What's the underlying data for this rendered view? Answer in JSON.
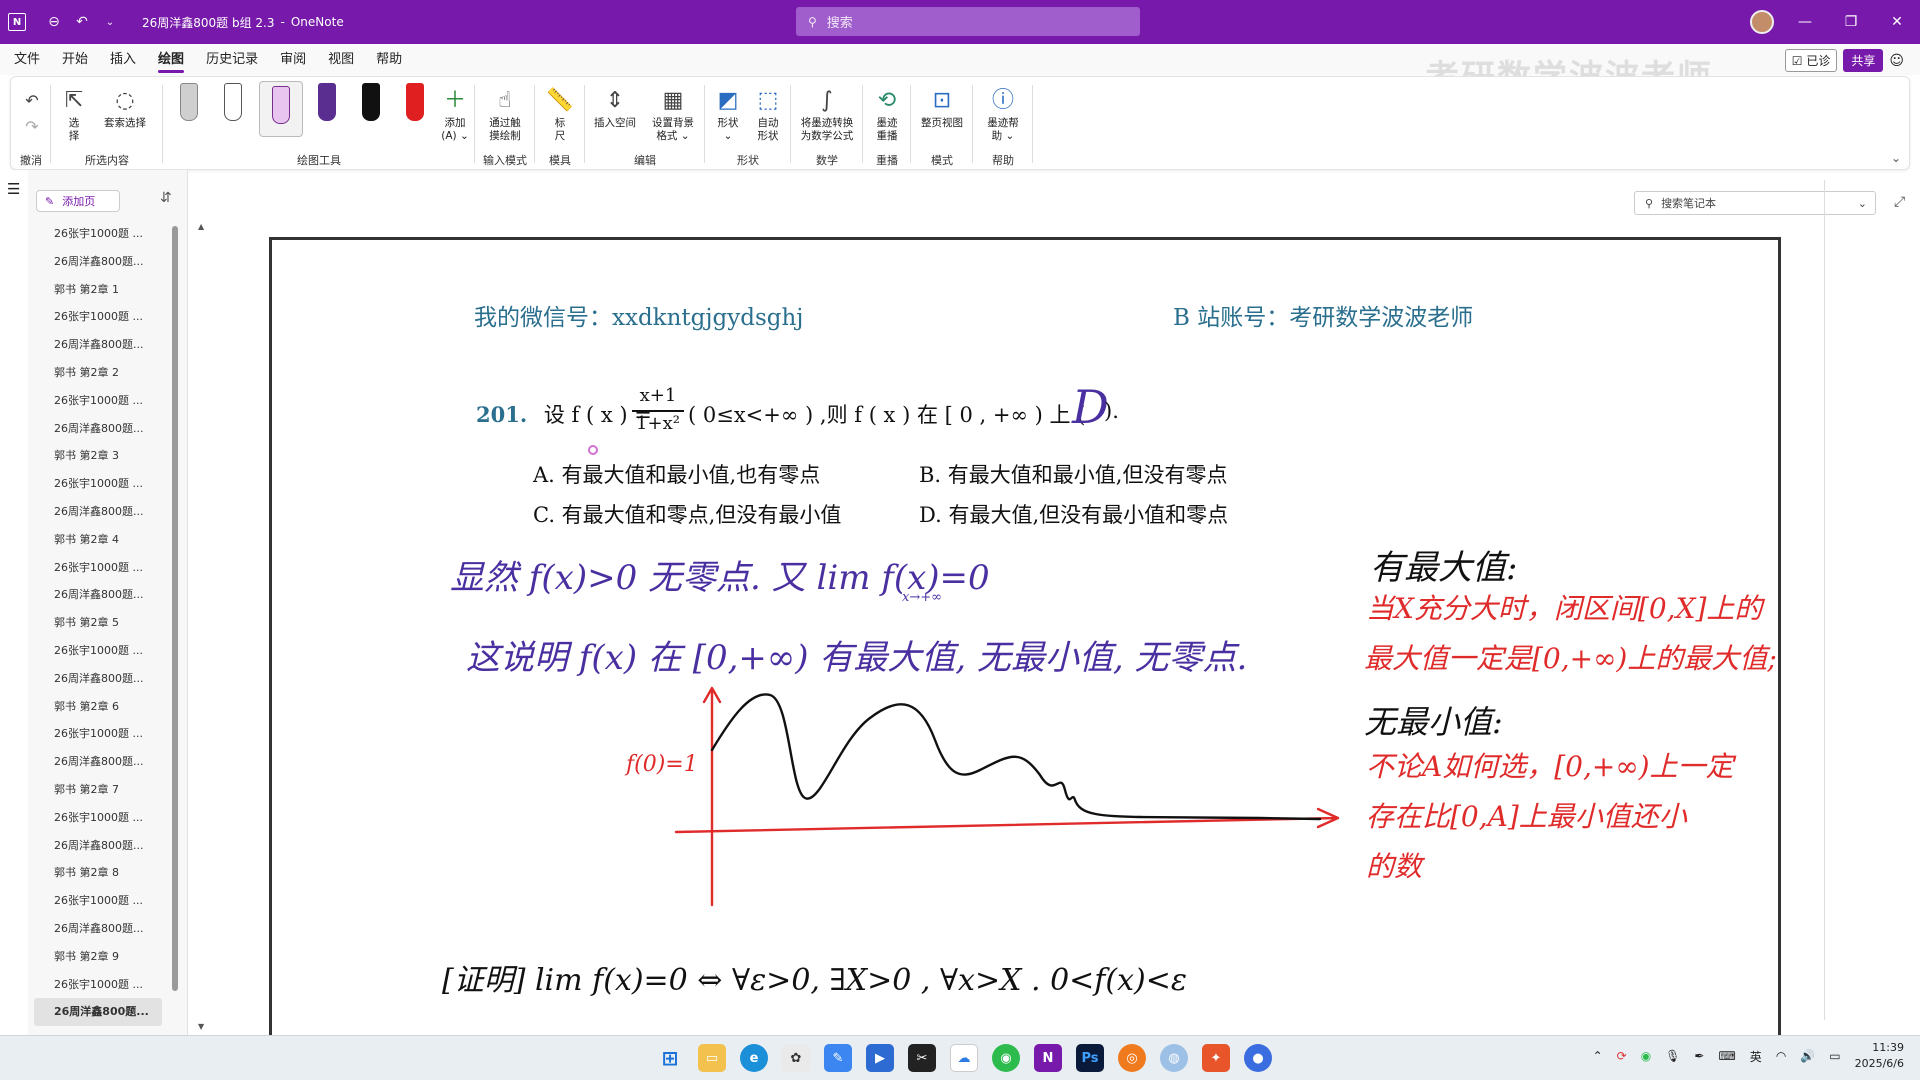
{
  "titlebar": {
    "doc_title": "26周洋鑫800题 b组 2.3",
    "app_name": "OneNote",
    "search_placeholder": "搜索",
    "app_icon": "N"
  },
  "menu": [
    "文件",
    "开始",
    "插入",
    "绘图",
    "历史记录",
    "审阅",
    "视图",
    "帮助"
  ],
  "watermark": "考研数学波波老师",
  "right_tools": {
    "check": "☑ 已诊",
    "share": "共享"
  },
  "ribbon": {
    "undo_label": "撤消",
    "select_buttons": [
      "选\n择",
      "套索选择"
    ],
    "select_group": "所选内容",
    "add_label": "添加\n(A) ⌄",
    "draw_group": "绘图工具",
    "touch_label": "通过触\n摸绘制",
    "input_group": "输入模式",
    "ruler_label": "标\n尺",
    "template_group": "模具",
    "edit_buttons": [
      "插入空间",
      "设置背景\n格式 ⌄"
    ],
    "edit_group": "编辑",
    "shape_buttons": [
      "形状\n⌄",
      "自动\n形状"
    ],
    "shape_group": "形状",
    "math_button": "将墨迹转换\n为数学公式",
    "math_group": "数学",
    "replay_button": "墨迹\n重播",
    "replay_group": "重播",
    "page_view_button": "整页视图",
    "mode_group": "模式",
    "help_button": "墨迹帮\n助 ⌄",
    "help_group": "帮助"
  },
  "pens": [
    "#b7b7b7",
    "#ffffff",
    "#e8c5ef",
    "#5a2d91",
    "#111111",
    "#e02020"
  ],
  "sidebar": {
    "add_page": "添加页",
    "pages": [
      "26张宇1000题 ...",
      "26周洋鑫800题...",
      "郭书 第2章 1",
      "26张宇1000题 ...",
      "26周洋鑫800题...",
      "郭书 第2章 2",
      "26张宇1000题 ...",
      "26周洋鑫800题...",
      "郭书 第2章 3",
      "26张宇1000题 ...",
      "26周洋鑫800题...",
      "郭书 第2章 4",
      "26张宇1000题 ...",
      "26周洋鑫800题...",
      "郭书 第2章 5",
      "26张宇1000题 ...",
      "26周洋鑫800题...",
      "郭书 第2章 6",
      "26张宇1000题 ...",
      "26周洋鑫800题...",
      "郭书 第2章 7",
      "26张宇1000题 ...",
      "26周洋鑫800题...",
      "郭书 第2章 8",
      "26张宇1000题 ...",
      "26周洋鑫800题...",
      "郭书 第2章 9",
      "26张宇1000题 ...",
      "26周洋鑫800题..."
    ],
    "selected_index": 28
  },
  "notebook_search": "搜索笔记本",
  "doc": {
    "wechat": "我的微信号：xxdkntgjgydsghj",
    "bilibili": "B 站账号：考研数学波波老师",
    "q_num": "201.",
    "q_pre": "设 f ( x ) =",
    "frac_num": "x+1",
    "frac_den": "1+x²",
    "q_post": "( 0≤x<+∞ ) ,则 f ( x ) 在 [ 0 , +∞ ) 上 (",
    "q_answer": "D",
    "q_end": ").",
    "opt_a": "A. 有最大值和最小值,也有零点",
    "opt_b": "B. 有最大值和最小值,但没有零点",
    "opt_c": "C. 有最大值和零点,但没有最小值",
    "opt_d": "D. 有最大值,但没有最小值和零点"
  },
  "handwriting": {
    "line1": "显然   f(x)>0   无零点.   又  lim f(x)=0",
    "line1_sub": "x→+∞",
    "line2": "这说明 f(x) 在 [0,+∞) 有最大值, 无最小值, 无零点.",
    "f0_label": "f(0)=1",
    "right_title1": "有最大值:",
    "right_red1": [
      "当X充分大时，闭区间[0,X]上的",
      "最大值一定是[0,+∞)上的最大值;"
    ],
    "right_title2": "无最小值:",
    "right_red2": [
      "不论A如何选，[0,+∞)上一定",
      "存在比[0,A]上最小值还小",
      "的数"
    ],
    "proof": "[证明]  lim f(x)=0  ⇔  ∀ε>0, ∃X>0 , ∀x>X . 0<f(x)<ε"
  },
  "taskbar": {
    "clock_time": "11:39",
    "clock_date": "2025/6/6",
    "ime": "英"
  }
}
